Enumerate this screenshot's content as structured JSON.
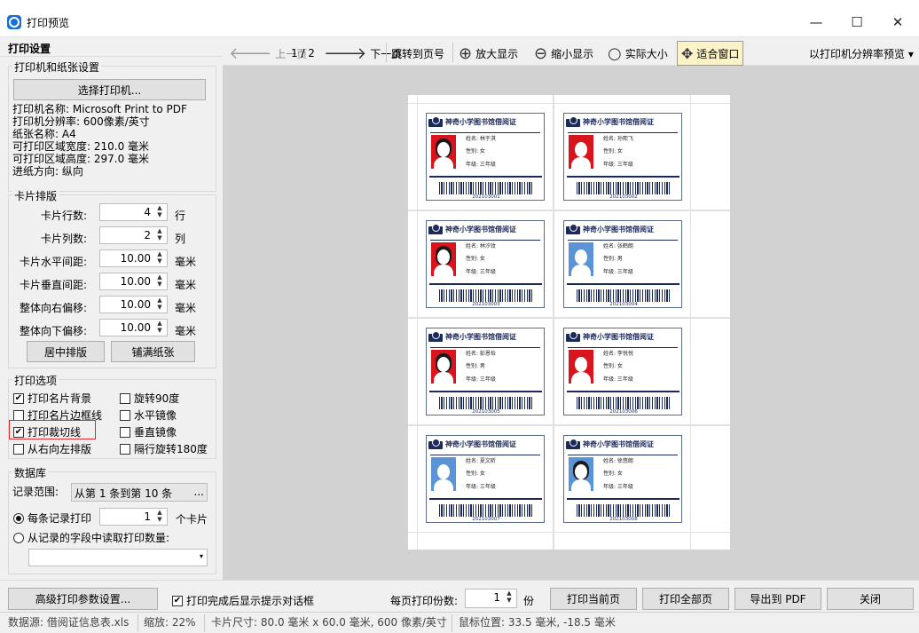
{
  "window": {
    "title": "打印预览",
    "minimize": "—",
    "maximize": "☐",
    "close": "✕"
  },
  "left": {
    "header": "打印设置",
    "printer_group": {
      "title": "打印机和纸张设置",
      "select_button": "选择打印机...",
      "lines": [
        "打印机名称: Microsoft Print to PDF",
        "打印机分辨率: 600像素/英寸",
        "纸张名称: A4",
        "可打印区域宽度: 210.0 毫米",
        "可打印区域高度: 297.0 毫米",
        "进纸方向: 纵向"
      ]
    },
    "layout_group": {
      "title": "卡片排版",
      "rows": [
        {
          "label": "卡片行数:",
          "value": "4",
          "unit": "行"
        },
        {
          "label": "卡片列数:",
          "value": "2",
          "unit": "列"
        },
        {
          "label": "卡片水平间距:",
          "value": "10.00",
          "unit": "毫米"
        },
        {
          "label": "卡片垂直间距:",
          "value": "10.00",
          "unit": "毫米"
        },
        {
          "label": "整体向右偏移:",
          "value": "10.00",
          "unit": "毫米"
        },
        {
          "label": "整体向下偏移:",
          "value": "10.00",
          "unit": "毫米"
        }
      ],
      "center_button": "居中排版",
      "fill_button": "铺满纸张"
    },
    "options_group": {
      "title": "打印选项",
      "opt1": {
        "label": "打印名片背景",
        "checked": true
      },
      "opt2": {
        "label": "打印名片边框线",
        "checked": false
      },
      "opt3": {
        "label": "打印裁切线",
        "checked": true
      },
      "opt4": {
        "label": "从右向左排版",
        "checked": false
      },
      "opt5": {
        "label": "旋转90度",
        "checked": false
      },
      "opt6": {
        "label": "水平镜像",
        "checked": false
      },
      "opt7": {
        "label": "垂直镜像",
        "checked": false
      },
      "opt8": {
        "label": "隔行旋转180度",
        "checked": false
      }
    },
    "db_group": {
      "title": "数据库",
      "range_label": "记录范围:",
      "range_value": "从第 1 条到第 10 条",
      "range_more": "...",
      "radio1": "每条记录打印",
      "radio1_value": "1",
      "radio1_unit": "个卡片",
      "radio2": "从记录的字段中读取打印数量:",
      "field_select": ""
    }
  },
  "toolbar": {
    "prev": "上一页",
    "page": "1 / 2",
    "next": "下一页",
    "jump": "跳转到页号",
    "zoom_in": "放大显示",
    "zoom_out": "缩小显示",
    "actual": "实际大小",
    "fit": "适合窗口",
    "resolution": "以打印机分辨率预览 ▾"
  },
  "cards": [
    {
      "title": "神奇小学图书馆借阅证",
      "name": "姓名: 林于淇",
      "gender": "性别: 女",
      "grade": "年级: 三年级",
      "code": "202103001",
      "bg": "#d8141c",
      "hair": true
    },
    {
      "title": "神奇小学图书馆借阅证",
      "name": "姓名: 孙熙飞",
      "gender": "性别: 女",
      "grade": "年级: 三年级",
      "code": "202103002",
      "bg": "#d8141c",
      "hair": false
    },
    {
      "title": "神奇小学图书馆借阅证",
      "name": "姓名: 林汐玟",
      "gender": "性别: 女",
      "grade": "年级: 三年级",
      "code": "202103003",
      "bg": "#d8141c",
      "hair": true
    },
    {
      "title": "神奇小学图书馆借阅证",
      "name": "姓名: 张鹤朗",
      "gender": "性别: 男",
      "grade": "年级: 三年级",
      "code": "202103004",
      "bg": "#5a93d6",
      "hair": false
    },
    {
      "title": "神奇小学图书馆借阅证",
      "name": "姓名: 彭恩怡",
      "gender": "性别: 男",
      "grade": "年级: 三年级",
      "code": "202103005",
      "bg": "#d8141c",
      "hair": true
    },
    {
      "title": "神奇小学图书馆借阅证",
      "name": "姓名: 李悦悦",
      "gender": "性别: 女",
      "grade": "年级: 三年级",
      "code": "202103006",
      "bg": "#d8141c",
      "hair": false
    },
    {
      "title": "神奇小学图书馆借阅证",
      "name": "姓名: 夏文昕",
      "gender": "性别: 女",
      "grade": "年级: 三年级",
      "code": "202103007",
      "bg": "#5a93d6",
      "hair": false
    },
    {
      "title": "神奇小学图书馆借阅证",
      "name": "姓名: 徐悠朗",
      "gender": "性别: 女",
      "grade": "年级: 三年级",
      "code": "202103008",
      "bg": "#5a93d6",
      "hair": true
    }
  ],
  "bottom": {
    "advanced": "高级打印参数设置...",
    "show_dialog": "打印完成后显示提示对话框",
    "copies_label": "每页打印份数:",
    "copies_value": "1",
    "copies_unit": "份",
    "print_current": "打印当前页",
    "print_all": "打印全部页",
    "export_pdf": "导出到 PDF",
    "close": "关闭"
  },
  "status": {
    "source": "数据源: 借阅证信息表.xls",
    "zoom": "缩放: 22%",
    "card_size": "卡片尺寸: 80.0 毫米 x 60.0 毫米, 600 像素/英寸",
    "mouse": "鼠标位置: 33.5 毫米, -18.5 毫米"
  },
  "colors": {
    "highlight": "#e0282c",
    "card_navy": "#1c2a5a"
  }
}
